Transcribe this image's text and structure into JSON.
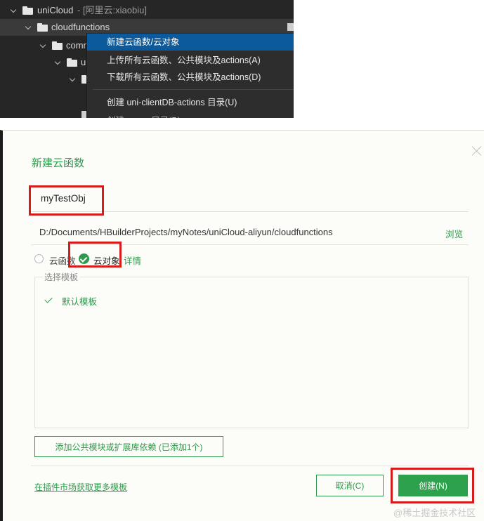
{
  "tree": {
    "root_label": "uniCloud",
    "root_suffix": "- [阿里云:xiaobiu]",
    "folder_label": "cloudfunctions",
    "child1_label": "comm",
    "child2_label": "u"
  },
  "context_menu": {
    "items": [
      "新建云函数/云对象",
      "上传所有云函数、公共模块及actions(A)",
      "下载所有云函数、公共模块及actions(D)",
      "创建 uni-clientDB-actions 目录(U)",
      "创建 ......... 目录(B)"
    ]
  },
  "dialog": {
    "title": "新建云函数",
    "name_value": "myTestObj",
    "path": "D:/Documents/HBuilderProjects/myNotes/uniCloud-aliyun/cloudfunctions",
    "browse_label": "浏览",
    "type_options": [
      "云函数",
      "云对象"
    ],
    "selected_type": "云对象",
    "details_label": "详情",
    "template_section_label": "选择模板",
    "template_selected": "默认模板",
    "add_dependency_label": "添加公共模块或扩展库依赖 (已添加1个)",
    "market_link": "在插件市场获取更多模板",
    "cancel_label": "取消(C)",
    "create_label": "创建(N)"
  },
  "watermark": "@稀土掘金技术社区",
  "colors": {
    "accent_green": "#2b9a4a",
    "highlight_blue": "#0c5a9b",
    "annotation_red": "#d61b1b",
    "dark_bg": "#262626"
  }
}
